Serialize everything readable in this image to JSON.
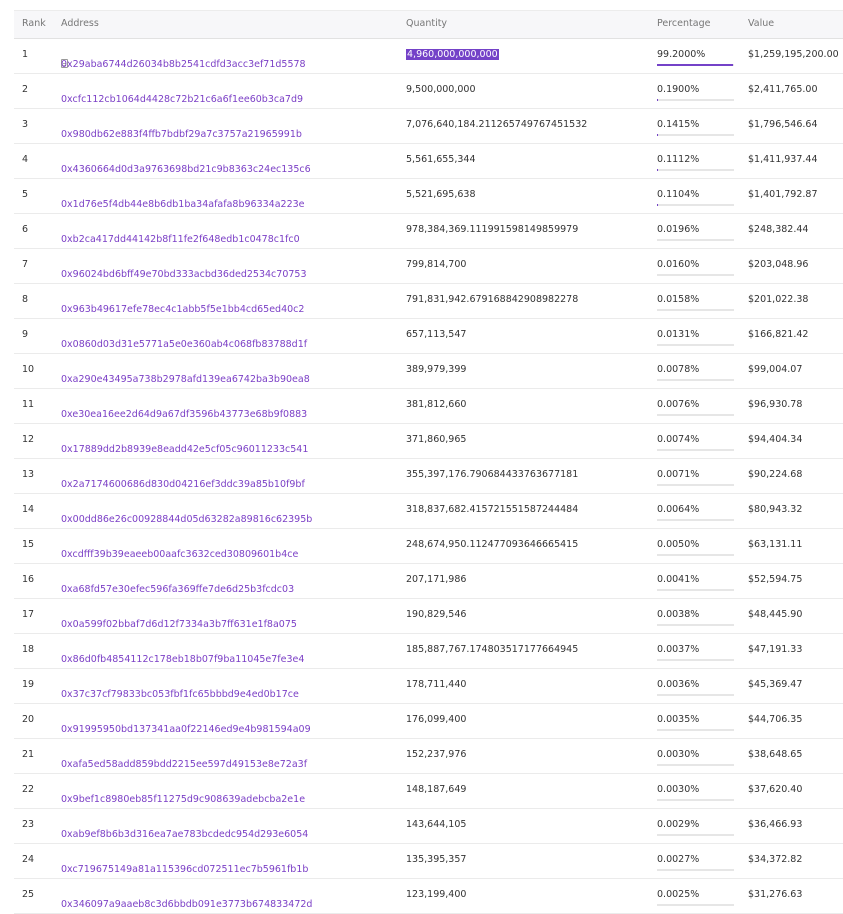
{
  "table": {
    "headers": {
      "rank": "Rank",
      "address": "Address",
      "quantity": "Quantity",
      "percentage": "Percentage",
      "value": "Value"
    },
    "rows": [
      {
        "rank": "1",
        "address": "0x29aba6744d26034b8b2541cdfd3acc3ef71d5578",
        "quantity": "4,960,000,000,000",
        "percentage": "99.2000%",
        "pct_fraction": 0.992,
        "value": "$1,259,195,200.00",
        "contract_icon": true,
        "quantity_selected": true
      },
      {
        "rank": "2",
        "address": "0xcfc112cb1064d4428c72b21c6a6f1ee60b3ca7d9",
        "quantity": "9,500,000,000",
        "percentage": "0.1900%",
        "pct_fraction": 0.0019,
        "value": "$2,411,765.00"
      },
      {
        "rank": "3",
        "address": "0x980db62e883f4ffb7bdbf29a7c3757a21965991b",
        "quantity": "7,076,640,184.211265749767451532",
        "percentage": "0.1415%",
        "pct_fraction": 0.001415,
        "value": "$1,796,546.64"
      },
      {
        "rank": "4",
        "address": "0x4360664d0d3a9763698bd21c9b8363c24ec135c6",
        "quantity": "5,561,655,344",
        "percentage": "0.1112%",
        "pct_fraction": 0.001112,
        "value": "$1,411,937.44"
      },
      {
        "rank": "5",
        "address": "0x1d76e5f4db44e8b6db1ba34afafa8b96334a223e",
        "quantity": "5,521,695,638",
        "percentage": "0.1104%",
        "pct_fraction": 0.001104,
        "value": "$1,401,792.87"
      },
      {
        "rank": "6",
        "address": "0xb2ca417dd44142b8f11fe2f648edb1c0478c1fc0",
        "quantity": "978,384,369.111991598149859979",
        "percentage": "0.0196%",
        "pct_fraction": 0.000196,
        "value": "$248,382.44"
      },
      {
        "rank": "7",
        "address": "0x96024bd6bff49e70bd333acbd36ded2534c70753",
        "quantity": "799,814,700",
        "percentage": "0.0160%",
        "pct_fraction": 0.00016,
        "value": "$203,048.96"
      },
      {
        "rank": "8",
        "address": "0x963b49617efe78ec4c1abb5f5e1bb4cd65ed40c2",
        "quantity": "791,831,942.679168842908982278",
        "percentage": "0.0158%",
        "pct_fraction": 0.000158,
        "value": "$201,022.38"
      },
      {
        "rank": "9",
        "address": "0x0860d03d31e5771a5e0e360ab4c068fb83788d1f",
        "quantity": "657,113,547",
        "percentage": "0.0131%",
        "pct_fraction": 0.000131,
        "value": "$166,821.42"
      },
      {
        "rank": "10",
        "address": "0xa290e43495a738b2978afd139ea6742ba3b90ea8",
        "quantity": "389,979,399",
        "percentage": "0.0078%",
        "pct_fraction": 7.8e-05,
        "value": "$99,004.07"
      },
      {
        "rank": "11",
        "address": "0xe30ea16ee2d64d9a67df3596b43773e68b9f0883",
        "quantity": "381,812,660",
        "percentage": "0.0076%",
        "pct_fraction": 7.6e-05,
        "value": "$96,930.78"
      },
      {
        "rank": "12",
        "address": "0x17889dd2b8939e8eadd42e5cf05c96011233c541",
        "quantity": "371,860,965",
        "percentage": "0.0074%",
        "pct_fraction": 7.4e-05,
        "value": "$94,404.34"
      },
      {
        "rank": "13",
        "address": "0x2a7174600686d830d04216ef3ddc39a85b10f9bf",
        "quantity": "355,397,176.790684433763677181",
        "percentage": "0.0071%",
        "pct_fraction": 7.1e-05,
        "value": "$90,224.68"
      },
      {
        "rank": "14",
        "address": "0x00dd86e26c00928844d05d63282a89816c62395b",
        "quantity": "318,837,682.415721551587244484",
        "percentage": "0.0064%",
        "pct_fraction": 6.4e-05,
        "value": "$80,943.32"
      },
      {
        "rank": "15",
        "address": "0xcdfff39b39eaeeb00aafc3632ced30809601b4ce",
        "quantity": "248,674,950.112477093646665415",
        "percentage": "0.0050%",
        "pct_fraction": 5e-05,
        "value": "$63,131.11"
      },
      {
        "rank": "16",
        "address": "0xa68fd57e30efec596fa369ffe7de6d25b3fcdc03",
        "quantity": "207,171,986",
        "percentage": "0.0041%",
        "pct_fraction": 4.1e-05,
        "value": "$52,594.75"
      },
      {
        "rank": "17",
        "address": "0x0a599f02bbaf7d6d12f7334a3b7ff631e1f8a075",
        "quantity": "190,829,546",
        "percentage": "0.0038%",
        "pct_fraction": 3.8e-05,
        "value": "$48,445.90"
      },
      {
        "rank": "18",
        "address": "0x86d0fb4854112c178eb18b07f9ba11045e7fe3e4",
        "quantity": "185,887,767.174803517177664945",
        "percentage": "0.0037%",
        "pct_fraction": 3.7e-05,
        "value": "$47,191.33"
      },
      {
        "rank": "19",
        "address": "0x37c37cf79833bc053fbf1fc65bbbd9e4ed0b17ce",
        "quantity": "178,711,440",
        "percentage": "0.0036%",
        "pct_fraction": 3.6e-05,
        "value": "$45,369.47"
      },
      {
        "rank": "20",
        "address": "0x91995950bd137341aa0f22146ed9e4b981594a09",
        "quantity": "176,099,400",
        "percentage": "0.0035%",
        "pct_fraction": 3.5e-05,
        "value": "$44,706.35"
      },
      {
        "rank": "21",
        "address": "0xafa5ed58add859bdd2215ee597d49153e8e72a3f",
        "quantity": "152,237,976",
        "percentage": "0.0030%",
        "pct_fraction": 3e-05,
        "value": "$38,648.65"
      },
      {
        "rank": "22",
        "address": "0x9bef1c8980eb85f11275d9c908639adebcba2e1e",
        "quantity": "148,187,649",
        "percentage": "0.0030%",
        "pct_fraction": 3e-05,
        "value": "$37,620.40"
      },
      {
        "rank": "23",
        "address": "0xab9ef8b6b3d316ea7ae783bcdedc954d293e6054",
        "quantity": "143,644,105",
        "percentage": "0.0029%",
        "pct_fraction": 2.9e-05,
        "value": "$36,466.93"
      },
      {
        "rank": "24",
        "address": "0xc719675149a81a115396cd072511ec7b5961fb1b",
        "quantity": "135,395,357",
        "percentage": "0.0027%",
        "pct_fraction": 2.7e-05,
        "value": "$34,372.82"
      },
      {
        "rank": "25",
        "address": "0x346097a9aaeb8c3d6bbdb091e3773b674833472d",
        "quantity": "123,199,400",
        "percentage": "0.0025%",
        "pct_fraction": 2.5e-05,
        "value": "$31,276.63"
      }
    ]
  },
  "colors": {
    "link": "#7b3fc6",
    "accent": "#7442c8",
    "header_bg": "#f7f7f9"
  }
}
